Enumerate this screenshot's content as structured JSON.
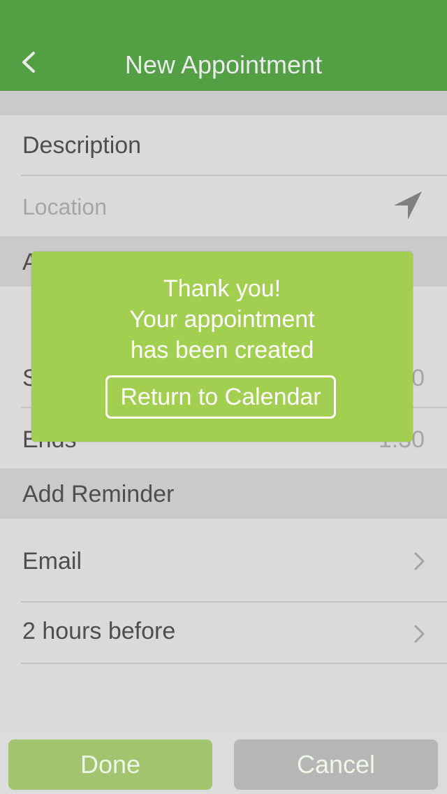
{
  "navbar": {
    "title": "New Appointment",
    "back_icon": "chevron-left-icon"
  },
  "form": {
    "description_label": "Description",
    "location_placeholder": "Location",
    "location_icon": "location-arrow-icon",
    "allday_section_label": "A",
    "starts_label": "S",
    "starts_value": "0",
    "ends_label": "Ends",
    "ends_value": "1:30"
  },
  "reminder": {
    "section_label": "Add Reminder",
    "method_label": "Email",
    "timing_label": "2 hours before"
  },
  "actions": {
    "done_label": "Done",
    "cancel_label": "Cancel"
  },
  "popup": {
    "line1": "Thank you!",
    "line2": "Your appointment",
    "line3": "has been created",
    "button_label": "Return to Calendar"
  },
  "colors": {
    "navbar": "#5aad4a",
    "popup": "#a3cf50",
    "done_button": "#a3c46e",
    "cancel_button": "#b6b6b6"
  }
}
